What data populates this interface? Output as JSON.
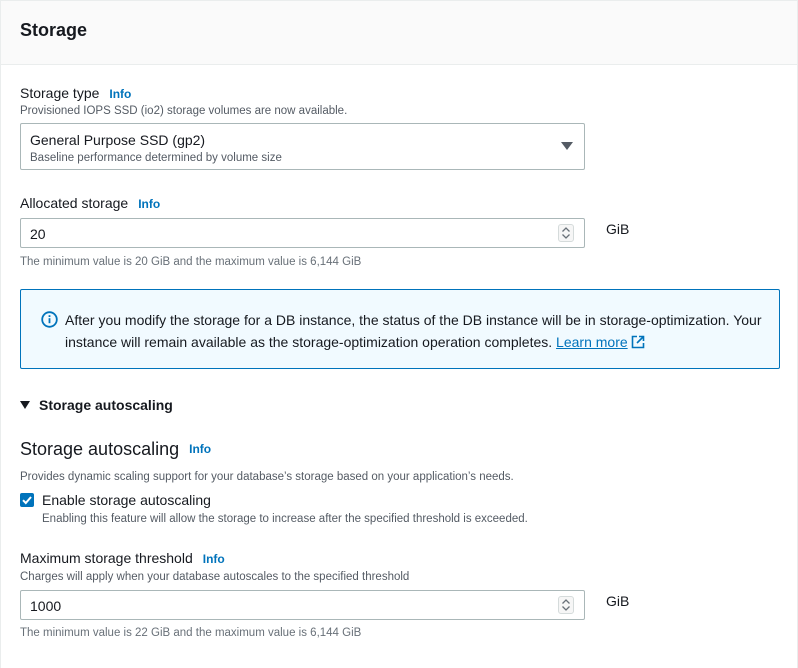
{
  "header": {
    "title": "Storage"
  },
  "info_label": "Info",
  "storage_type": {
    "label": "Storage type",
    "description": "Provisioned IOPS SSD (io2) storage volumes are now available.",
    "selected": "General Purpose SSD (gp2)",
    "selected_sub": "Baseline performance determined by volume size"
  },
  "allocated_storage": {
    "label": "Allocated storage",
    "value": "20",
    "unit": "GiB",
    "hint": "The minimum value is 20 GiB and the maximum value is 6,144 GiB"
  },
  "alert": {
    "text": "After you modify the storage for a DB instance, the status of the DB instance will be in storage-optimization. Your instance will remain available as the storage-optimization operation completes.",
    "link": "Learn more"
  },
  "autoscaling_expander": {
    "label": "Storage autoscaling"
  },
  "autoscaling": {
    "title": "Storage autoscaling",
    "description": "Provides dynamic scaling support for your database’s storage based on your application’s needs.",
    "checkbox_label": "Enable storage autoscaling",
    "checkbox_checked": true,
    "checkbox_description": "Enabling this feature will allow the storage to increase after the specified threshold is exceeded."
  },
  "max_threshold": {
    "label": "Maximum storage threshold",
    "description": "Charges will apply when your database autoscales to the specified threshold",
    "value": "1000",
    "unit": "GiB",
    "hint": "The minimum value is 22 GiB and the maximum value is 6,144 GiB"
  },
  "colors": {
    "link": "#0073bb",
    "alert_bg": "#f1faff",
    "checkbox": "#0073bb"
  }
}
